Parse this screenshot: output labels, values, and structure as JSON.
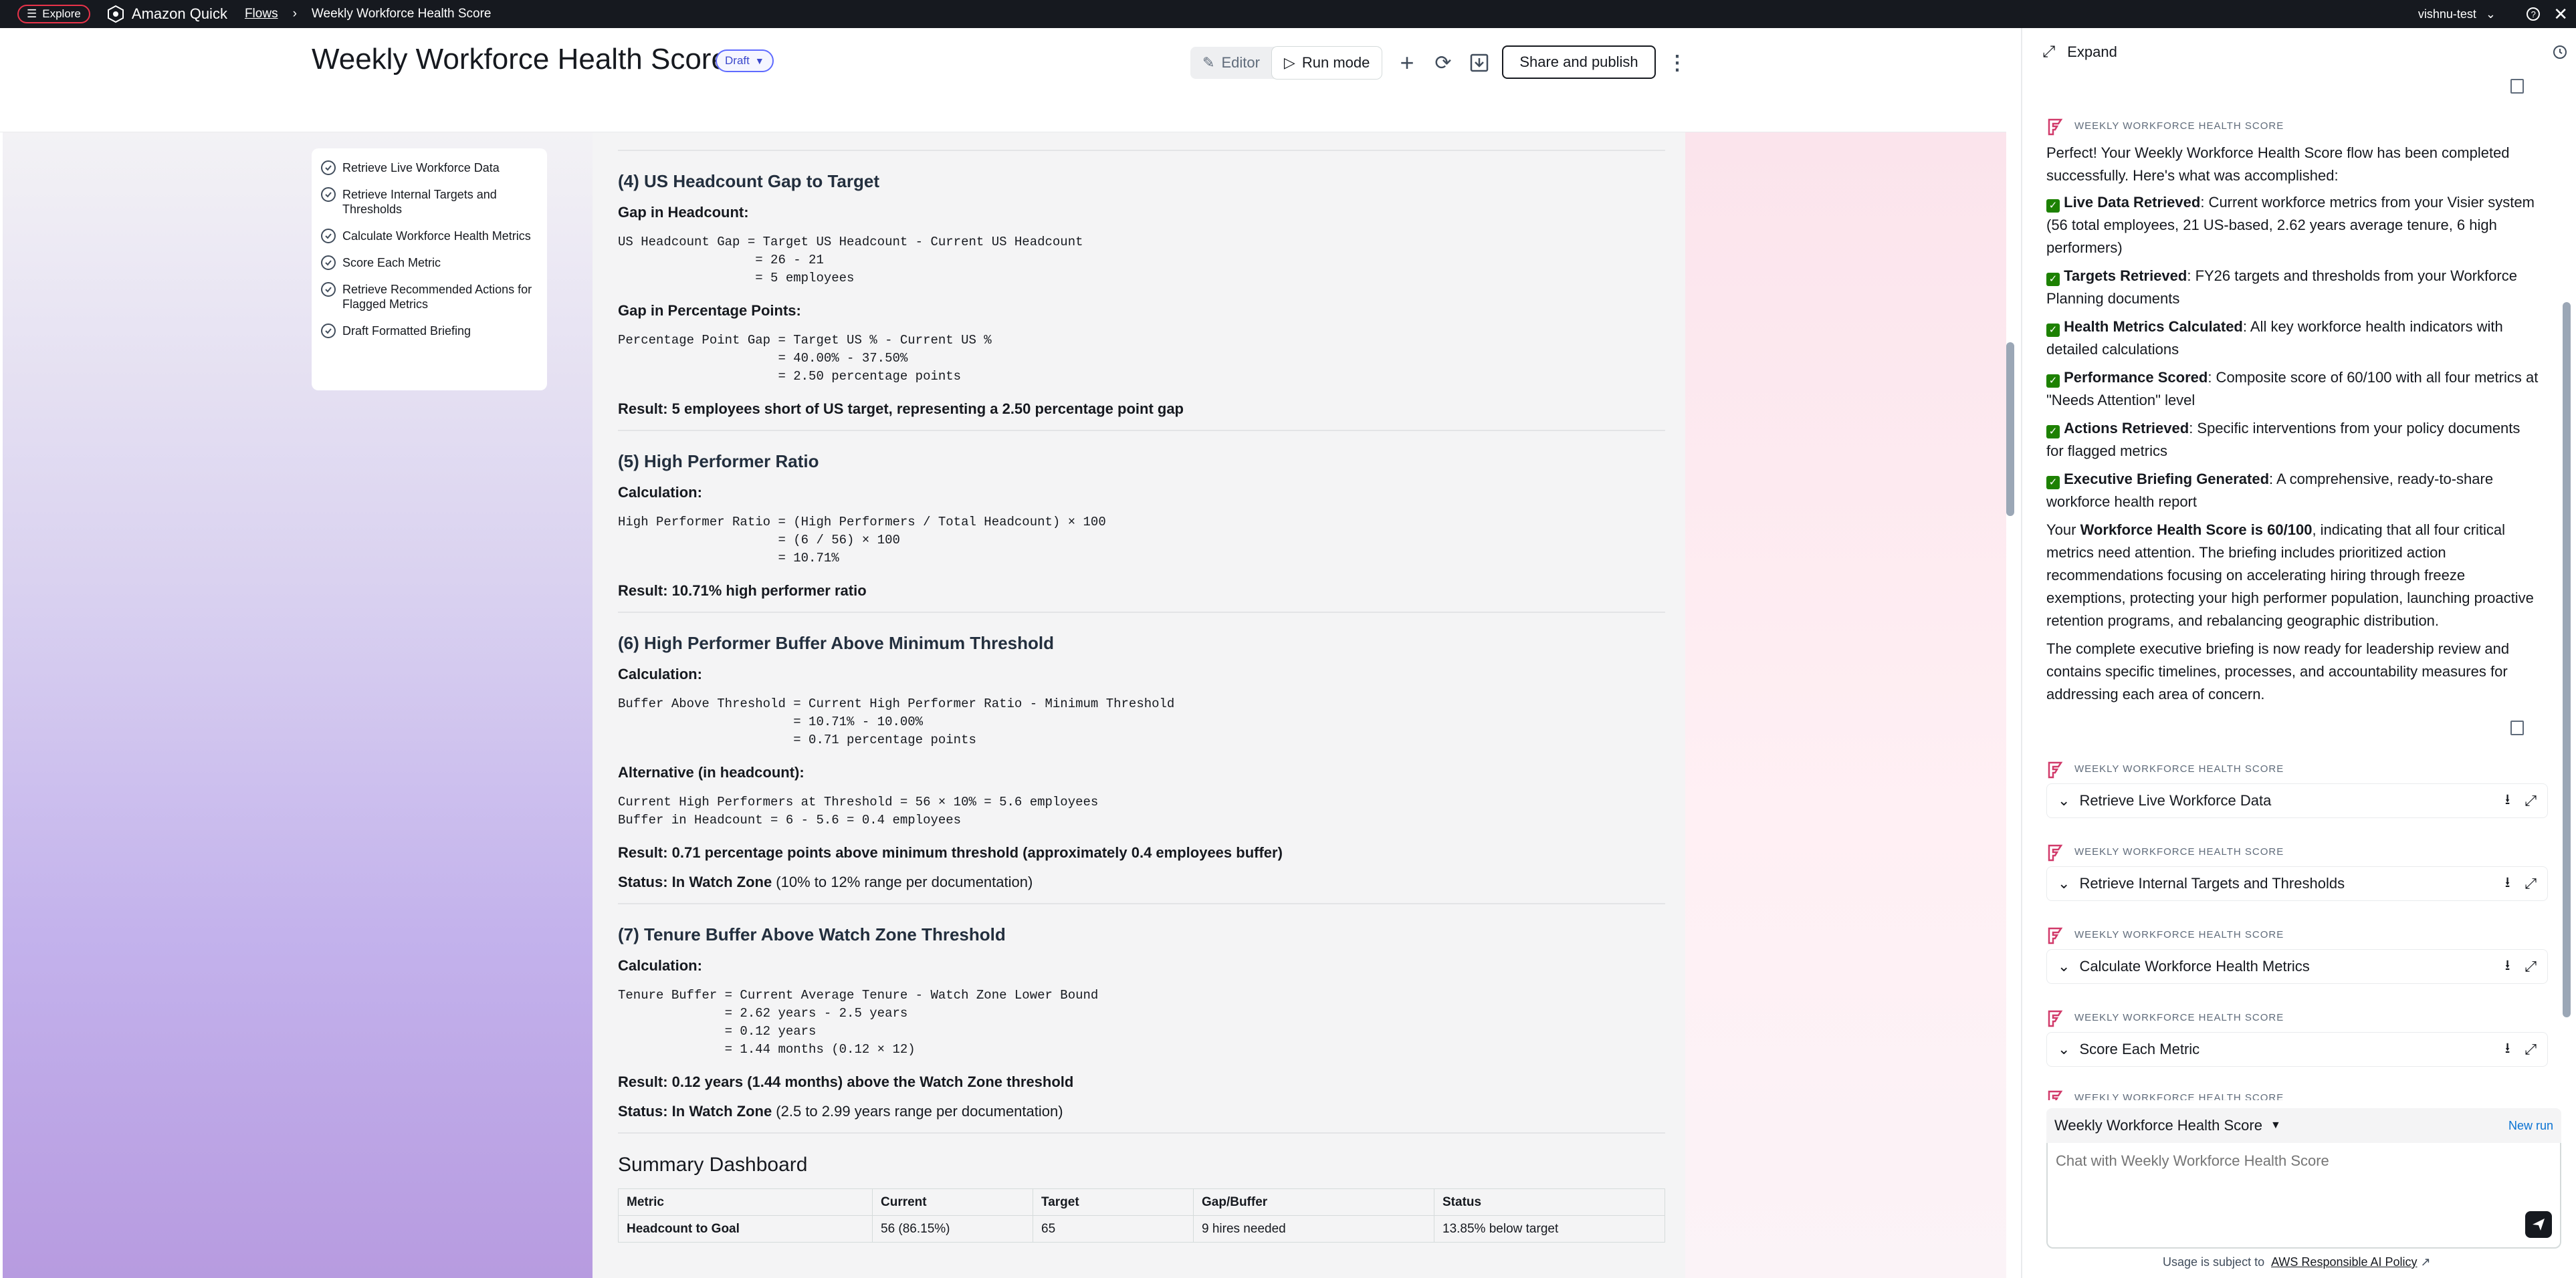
{
  "topbar": {
    "explore_label": "Explore",
    "brand": "Amazon Quick",
    "breadcrumb_flows": "Flows",
    "breadcrumb_current": "Weekly Workforce Health Score",
    "user": "vishnu-test"
  },
  "header": {
    "title": "Weekly Workforce Health Score",
    "badge": "Draft",
    "editor_label": "Editor",
    "run_mode_label": "Run mode",
    "share_label": "Share and publish"
  },
  "steps": [
    "Retrieve Live Workforce Data",
    "Retrieve Internal Targets and Thresholds",
    "Calculate Workforce Health Metrics",
    "Score Each Metric",
    "Retrieve Recommended Actions for Flagged Metrics",
    "Draft Formatted Briefing"
  ],
  "doc": {
    "s4": {
      "heading": "(4) US Headcount Gap to Target",
      "gap_label": "Gap in Headcount:",
      "gap_formula": "US Headcount Gap = Target US Headcount - Current US Headcount\n                  = 26 - 21\n                  = 5 employees",
      "pp_label": "Gap in Percentage Points:",
      "pp_formula": "Percentage Point Gap = Target US % - Current US %\n                     = 40.00% - 37.50%\n                     = 2.50 percentage points",
      "result": "Result: 5 employees short of US target, representing a 2.50 percentage point gap"
    },
    "s5": {
      "heading": "(5) High Performer Ratio",
      "calc_label": "Calculation:",
      "formula": "High Performer Ratio = (High Performers / Total Headcount) × 100\n                     = (6 / 56) × 100\n                     = 10.71%",
      "result": "Result: 10.71% high performer ratio"
    },
    "s6": {
      "heading": "(6) High Performer Buffer Above Minimum Threshold",
      "calc_label": "Calculation:",
      "formula": "Buffer Above Threshold = Current High Performer Ratio - Minimum Threshold\n                       = 10.71% - 10.00%\n                       = 0.71 percentage points",
      "alt_label": "Alternative (in headcount):",
      "alt_formula": "Current High Performers at Threshold = 56 × 10% = 5.6 employees\nBuffer in Headcount = 6 - 5.6 = 0.4 employees",
      "result": "Result: 0.71 percentage points above minimum threshold (approximately 0.4 employees buffer)",
      "status_bold": "Status: In Watch Zone",
      "status_rest": " (10% to 12% range per documentation)"
    },
    "s7": {
      "heading": "(7) Tenure Buffer Above Watch Zone Threshold",
      "calc_label": "Calculation:",
      "formula": "Tenure Buffer = Current Average Tenure - Watch Zone Lower Bound\n              = 2.62 years - 2.5 years\n              = 0.12 years\n              = 1.44 months (0.12 × 12)",
      "result": "Result: 0.12 years (1.44 months) above the Watch Zone threshold",
      "status_bold": "Status: In Watch Zone",
      "status_rest": " (2.5 to 2.99 years range per documentation)"
    },
    "summary": {
      "heading": "Summary Dashboard",
      "columns": [
        "Metric",
        "Current",
        "Target",
        "Gap/Buffer",
        "Status"
      ],
      "row1": [
        "Headcount to Goal",
        "56 (86.15%)",
        "65",
        "9 hires needed",
        "13.85% below target"
      ]
    }
  },
  "panel": {
    "expand_label": "Expand",
    "flow_label": "WEEKLY WORKFORCE HEALTH SCORE",
    "intro": "Perfect! Your Weekly Workforce Health Score flow has been completed successfully. Here's what was accomplished:",
    "items": [
      {
        "bold": "Live Data Retrieved",
        "rest": ": Current workforce metrics from your Visier system (56 total employees, 21 US-based, 2.62 years average tenure, 6 high performers)"
      },
      {
        "bold": "Targets Retrieved",
        "rest": ": FY26 targets and thresholds from your Workforce Planning documents"
      },
      {
        "bold": "Health Metrics Calculated",
        "rest": ": All key workforce health indicators with detailed calculations"
      },
      {
        "bold": "Performance Scored",
        "rest": ": Composite score of 60/100 with all four metrics at \"Needs Attention\" level"
      },
      {
        "bold": "Actions Retrieved",
        "rest": ": Specific interventions from your policy documents for flagged metrics"
      },
      {
        "bold": "Executive Briefing Generated",
        "rest": ": A comprehensive, ready-to-share workforce health report"
      }
    ],
    "score_pre": "Your ",
    "score_bold": "Workforce Health Score is 60/100",
    "score_rest": ", indicating that all four critical metrics need attention. The briefing includes prioritized action recommendations focusing on accelerating hiring through freeze exemptions, protecting your high performer population, launching proactive retention programs, and rebalancing geographic distribution.",
    "closing": "The complete executive briefing is now ready for leadership review and contains specific timelines, processes, and accountability measures for addressing each area of concern.",
    "cards": [
      "Retrieve Live Workforce Data",
      "Retrieve Internal Targets and Thresholds",
      "Calculate Workforce Health Metrics",
      "Score Each Metric"
    ],
    "selector": "Weekly Workforce Health Score",
    "new_run": "New run",
    "chat_placeholder": "Chat with Weekly Workforce Health Score",
    "usage_text": "Usage is subject to",
    "usage_link": "AWS Responsible AI Policy"
  },
  "colors": {
    "accent": "#5f6bff",
    "topbar": "#16191f",
    "check": "#1d8102"
  }
}
